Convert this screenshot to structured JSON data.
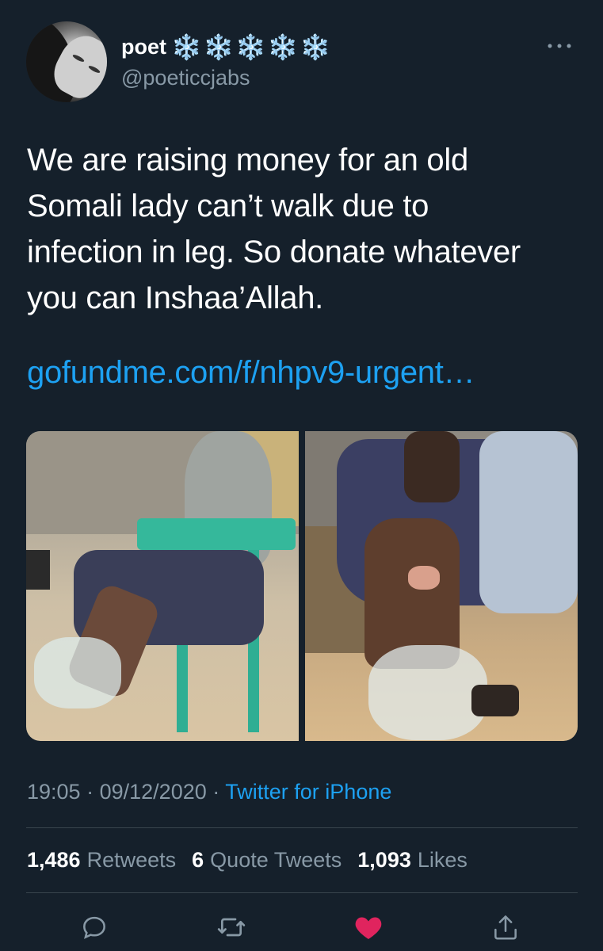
{
  "profile": {
    "display_name": "poet",
    "emoji": [
      "❄️",
      "❄️",
      "❄️",
      "❄️",
      "❄️"
    ],
    "handle": "@poeticcjabs",
    "avatar_icon": "profile-photo"
  },
  "tweet": {
    "text": "We are raising money for an old\nSomali lady can’t walk due to\ninfection in leg. So donate whatever\nyou can Inshaa’Allah.",
    "link": "gofundme.com/f/nhpv9-urgent…"
  },
  "meta": {
    "time": "19:05",
    "separator": "·",
    "date": "09/12/2020",
    "source": "Twitter for iPhone"
  },
  "stats": {
    "retweets_count": "1,486",
    "retweets_label": "Retweets",
    "quotes_count": "6",
    "quotes_label": "Quote Tweets",
    "likes_count": "1,093",
    "likes_label": "Likes"
  },
  "actions": {
    "reply_icon": "reply-icon",
    "retweet_icon": "retweet-icon",
    "like_icon": "heart-icon",
    "share_icon": "share-icon"
  },
  "colors": {
    "background": "#15202b",
    "link": "#1da1f2",
    "secondary_text": "#8899a6",
    "like": "#e0245e",
    "snowflake": "#8ecdf2"
  }
}
